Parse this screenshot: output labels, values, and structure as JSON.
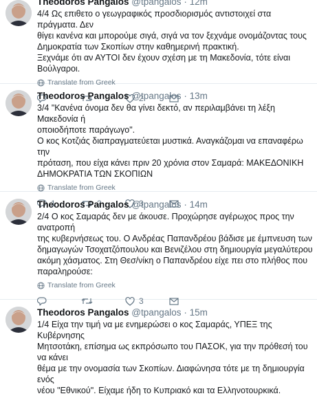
{
  "tweets": [
    {
      "name": "Theodoros Pangalos",
      "handle": "@tpangalos",
      "time": "· 12m",
      "lines": [
        "4/4 Ως επιθετο ο γεωγραφικός προσδιορισμός αντιστοιχεί στα πράγματα. Δεν",
        "θίγει κανένα και μπορούμε σιγά, σιγά να τον ξεχνάμε ονομάζοντας τους",
        "Δημοκρατία των Σκοπίων στην καθημερινή πρακτική.",
        "Ξεχνάμε ότι αν ΑΥΤΟΙ δεν έχουν σχέση με τη Μακεδονία, τότε είναι Βούλγαροι."
      ],
      "translate": "Translate from Greek",
      "replies": "",
      "retweets": "",
      "likes": "2"
    },
    {
      "name": "Theodoros Pangalos",
      "handle": "@tpangalos",
      "time": "· 13m",
      "lines": [
        "3/4 \"Κανένα όνομα δεν θα γίνει δεκτό, αν περιλαμβάνει τη λέξη Μακεδονία ή",
        "οποιοδήποτε παράγωγο\".",
        "Ο κος Κοτζιάς διαπραγματεύεται μυστικά. Αναγκάζομαι να επαναφέρω την",
        "πρόταση, που είχα κάνει πριν 20 χρόνια στον Σαμαρά: ΜΑΚΕΔΟΝΙΚΗ",
        "ΔΗΜΟΚΡΑΤΙΑ ΤΩΝ ΣΚΟΠΙΩΝ"
      ],
      "translate": "Translate from Greek",
      "replies": "1",
      "retweets": "2",
      "likes": "3"
    },
    {
      "name": "Theodoros Pangalos",
      "handle": "@tpangalos",
      "time": "· 14m",
      "lines": [
        "2/4 Ο κος Σαμαράς δεν με άκουσε. Προχώρησε αγέρωχος προς την ανατροπή",
        "της κυβερνήσεως του. Ο Ανδρέας Παπανδρέου βάδισε με έμπνευση των",
        "δημαγωγών Τσοχατζόπουλου και Βενιζέλου στη δημιουργία μεγαλύτερου",
        "ακόμη χάσματος. Στη Θεσ/νίκη ο Παπανδρέου είχε πει στο πλήθος που",
        "παραληρούσε:"
      ],
      "translate": "Translate from Greek",
      "replies": "",
      "retweets": "",
      "likes": "3"
    },
    {
      "name": "Theodoros Pangalos",
      "handle": "@tpangalos",
      "time": "· 15m",
      "lines": [
        "1/4 Είχα την τιμή να με ενημερώσει ο κος Σαμαράς, ΥΠΕΞ της Κυβέρνησης",
        "Μητσοτάκη, επίσημα ως εκπρόσωπο του ΠΑΣΟΚ, για την πρόθεσή του να κάνει",
        "θέμα με την ονομασία των Σκοπίων. Διαφώνησα τότε με τη δημιουργία ενός",
        "νέου \"Εθνικού\". Είχαμε ήδη το Κυπριακό και τα Ελληνοτουρκικά."
      ]
    }
  ]
}
